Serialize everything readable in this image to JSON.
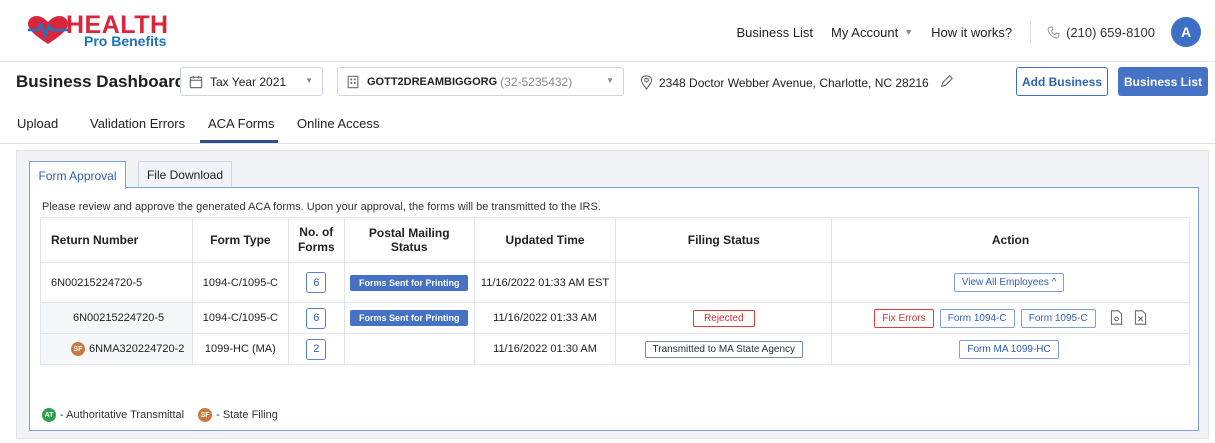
{
  "brand": {
    "name_top": "HEALTH",
    "name_bottom": "Pro Benefits",
    "red": "#d9263c",
    "blue": "#1e73be"
  },
  "topnav": {
    "business_list": "Business List",
    "my_account": "My Account",
    "how_it_works": "How it works?",
    "phone": "(210) 659-8100",
    "avatar_initial": "A"
  },
  "dashboard": {
    "title": "Business Dashboard",
    "tax_year": "Tax Year 2021",
    "business_name": "GOTT2DREAMBIGGORG",
    "business_ein": "(32-5235432)",
    "address": "2348 Doctor Webber Avenue, Charlotte, NC 28216",
    "add_business": "Add Business",
    "business_list": "Business List"
  },
  "tabs": [
    {
      "label": "Upload"
    },
    {
      "label": "Validation Errors"
    },
    {
      "label": "ACA Forms"
    },
    {
      "label": "Online Access"
    }
  ],
  "subtabs": [
    {
      "label": "Form Approval"
    },
    {
      "label": "File Download"
    }
  ],
  "note": "Please review and approve the generated ACA forms. Upon your approval, the forms will be transmitted to the IRS.",
  "table": {
    "headers": [
      "Return Number",
      "Form Type",
      "No. of Forms",
      "Postal Mailing Status",
      "Updated Time",
      "Filing Status",
      "Action"
    ],
    "main_row": {
      "return_number": "6N00215224720-5",
      "form_type": "1094-C/1095-C",
      "count": "6",
      "postal": "Forms Sent for Printing",
      "updated": "11/16/2022 01:33 AM EST",
      "filing": "",
      "action": "View All Employees ^"
    },
    "child_rows": [
      {
        "badge": "",
        "return_number": "6N00215224720-5",
        "form_type": "1094-C/1095-C",
        "count": "6",
        "postal": "Forms Sent for Printing",
        "updated": "11/16/2022 01:33 AM",
        "filing": "Rejected",
        "actions": [
          "Fix Errors",
          "Form 1094-C",
          "Form 1095-C"
        ]
      },
      {
        "badge": "SF",
        "return_number": "6NMA320224720-2",
        "form_type": "1099-HC (MA)",
        "count": "2",
        "postal": "",
        "updated": "11/16/2022 01:30 AM",
        "filing": "Transmitted to MA State Agency",
        "actions": [
          "Form MA 1099-HC"
        ]
      }
    ]
  },
  "legend": {
    "at_badge": "AT",
    "at_label": "- Authoritative Transmittal",
    "sf_badge": "SF",
    "sf_label": "- State Filing"
  }
}
